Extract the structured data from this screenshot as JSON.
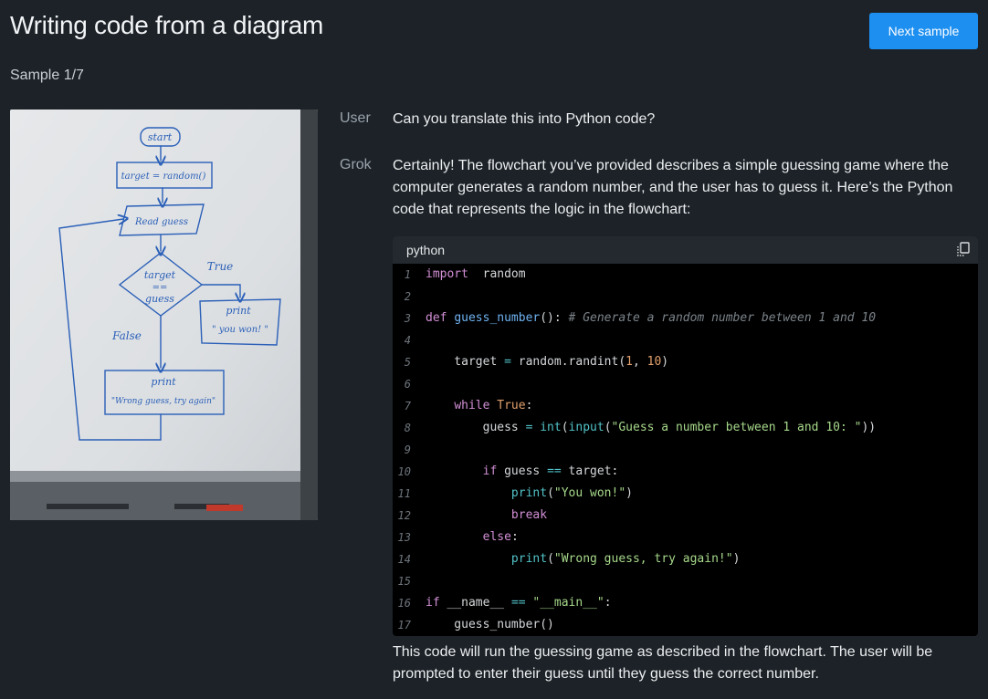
{
  "header": {
    "title": "Writing code from a diagram",
    "next_label": "Next sample",
    "sample_counter": "Sample 1/7"
  },
  "whiteboard": {
    "start": "start",
    "assign": "target = random()",
    "read": "Read guess",
    "cond_line1": "target",
    "cond_line2": "==",
    "cond_line3": "guess",
    "true_label": "True",
    "false_label": "False",
    "print_win_1": "print",
    "print_win_2": "\" you won! \"",
    "print_wrong_1": "print",
    "print_wrong_2": "\"Wrong guess, try again\""
  },
  "conversation": {
    "user_role": "User",
    "user_text": "Can you translate this into Python code?",
    "assistant_role": "Grok",
    "assistant_intro": "Certainly! The flowchart you’ve provided describes a simple guessing game where the computer generates a random number, and the user has to guess it. Here’s the Python code that represents the logic in the flowchart:",
    "assistant_outro": "This code will run the guessing game as described in the flowchart. The user will be prompted to enter their guess until they guess the correct number."
  },
  "code_block": {
    "language": "python",
    "copy_icon": "copy-icon",
    "lines": [
      {
        "n": "1",
        "t": [
          [
            "kw",
            "import"
          ],
          [
            "",
            "  random"
          ]
        ]
      },
      {
        "n": "2",
        "t": []
      },
      {
        "n": "3",
        "t": [
          [
            "kw",
            "def"
          ],
          [
            "",
            " "
          ],
          [
            "fn",
            "guess_number"
          ],
          [
            "",
            "(): "
          ],
          [
            "cm",
            "# Generate a random number between 1 and 10"
          ]
        ]
      },
      {
        "n": "4",
        "t": []
      },
      {
        "n": "5",
        "t": [
          [
            "",
            "    target "
          ],
          [
            "op",
            "="
          ],
          [
            "",
            " random.randint("
          ],
          [
            "num",
            "1"
          ],
          [
            "",
            ", "
          ],
          [
            "num",
            "10"
          ],
          [
            "",
            ")"
          ]
        ]
      },
      {
        "n": "6",
        "t": []
      },
      {
        "n": "7",
        "t": [
          [
            "",
            "    "
          ],
          [
            "kw",
            "while"
          ],
          [
            "",
            " "
          ],
          [
            "kw2",
            "True"
          ],
          [
            "",
            ":"
          ]
        ]
      },
      {
        "n": "8",
        "t": [
          [
            "",
            "        guess "
          ],
          [
            "op",
            "="
          ],
          [
            "",
            " "
          ],
          [
            "bi",
            "int"
          ],
          [
            "",
            "("
          ],
          [
            "bi",
            "input"
          ],
          [
            "",
            "("
          ],
          [
            "str",
            "\"Guess a number between 1 and 10: \""
          ],
          [
            "",
            "))"
          ]
        ]
      },
      {
        "n": "9",
        "t": []
      },
      {
        "n": "10",
        "t": [
          [
            "",
            "        "
          ],
          [
            "kw",
            "if"
          ],
          [
            "",
            " guess "
          ],
          [
            "op",
            "=="
          ],
          [
            "",
            " target:"
          ]
        ]
      },
      {
        "n": "11",
        "t": [
          [
            "",
            "            "
          ],
          [
            "bi",
            "print"
          ],
          [
            "",
            "("
          ],
          [
            "str",
            "\"You won!\""
          ],
          [
            "",
            ")"
          ]
        ]
      },
      {
        "n": "12",
        "t": [
          [
            "",
            "            "
          ],
          [
            "kw",
            "break"
          ]
        ]
      },
      {
        "n": "13",
        "t": [
          [
            "",
            "        "
          ],
          [
            "kw",
            "else"
          ],
          [
            "",
            ":"
          ]
        ]
      },
      {
        "n": "14",
        "t": [
          [
            "",
            "            "
          ],
          [
            "bi",
            "print"
          ],
          [
            "",
            "("
          ],
          [
            "str",
            "\"Wrong guess, try again!\""
          ],
          [
            "",
            ")"
          ]
        ]
      },
      {
        "n": "15",
        "t": []
      },
      {
        "n": "16",
        "t": [
          [
            "kw",
            "if"
          ],
          [
            "",
            " __name__ "
          ],
          [
            "op",
            "=="
          ],
          [
            "",
            " "
          ],
          [
            "str",
            "\"__main__\""
          ],
          [
            "",
            ":"
          ]
        ]
      },
      {
        "n": "17",
        "t": [
          [
            "",
            "    guess_number()"
          ]
        ]
      }
    ]
  },
  "colors": {
    "background": "#1c2228",
    "button": "#1d8ff0",
    "code_bg": "#000000",
    "marker": "#2a5fb8"
  }
}
